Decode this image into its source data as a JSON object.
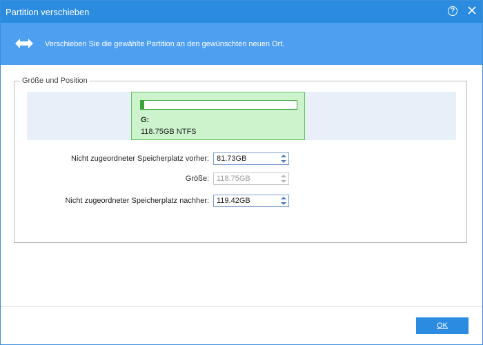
{
  "window": {
    "title": "Partition verschieben"
  },
  "banner": {
    "description": "Verschieben Sie die gewählte Partition an den gewünschten neuen Ort."
  },
  "group": {
    "legend": "Größe und Position"
  },
  "partition": {
    "letter": "G:",
    "info": "118.75GB NTFS",
    "usage_fraction": 0.02
  },
  "fields": {
    "before_label": "Nicht zugeordneter Speicherplatz vorher:",
    "before_value": "81.73GB",
    "size_label": "Größe:",
    "size_value": "118.75GB",
    "after_label": "Nicht zugeordneter Speicherplatz nachher:",
    "after_value": "119.42GB"
  },
  "footer": {
    "ok_label": "OK"
  },
  "colors": {
    "titlebar": "#2a8bdf",
    "banner": "#4f9ff0",
    "partition_fill": "#ccf3cc",
    "partition_border": "#5cc45c",
    "ok_button": "#2b8be0"
  },
  "icons": {
    "help": "help-icon",
    "close": "close-icon",
    "move": "move-arrows-icon"
  }
}
